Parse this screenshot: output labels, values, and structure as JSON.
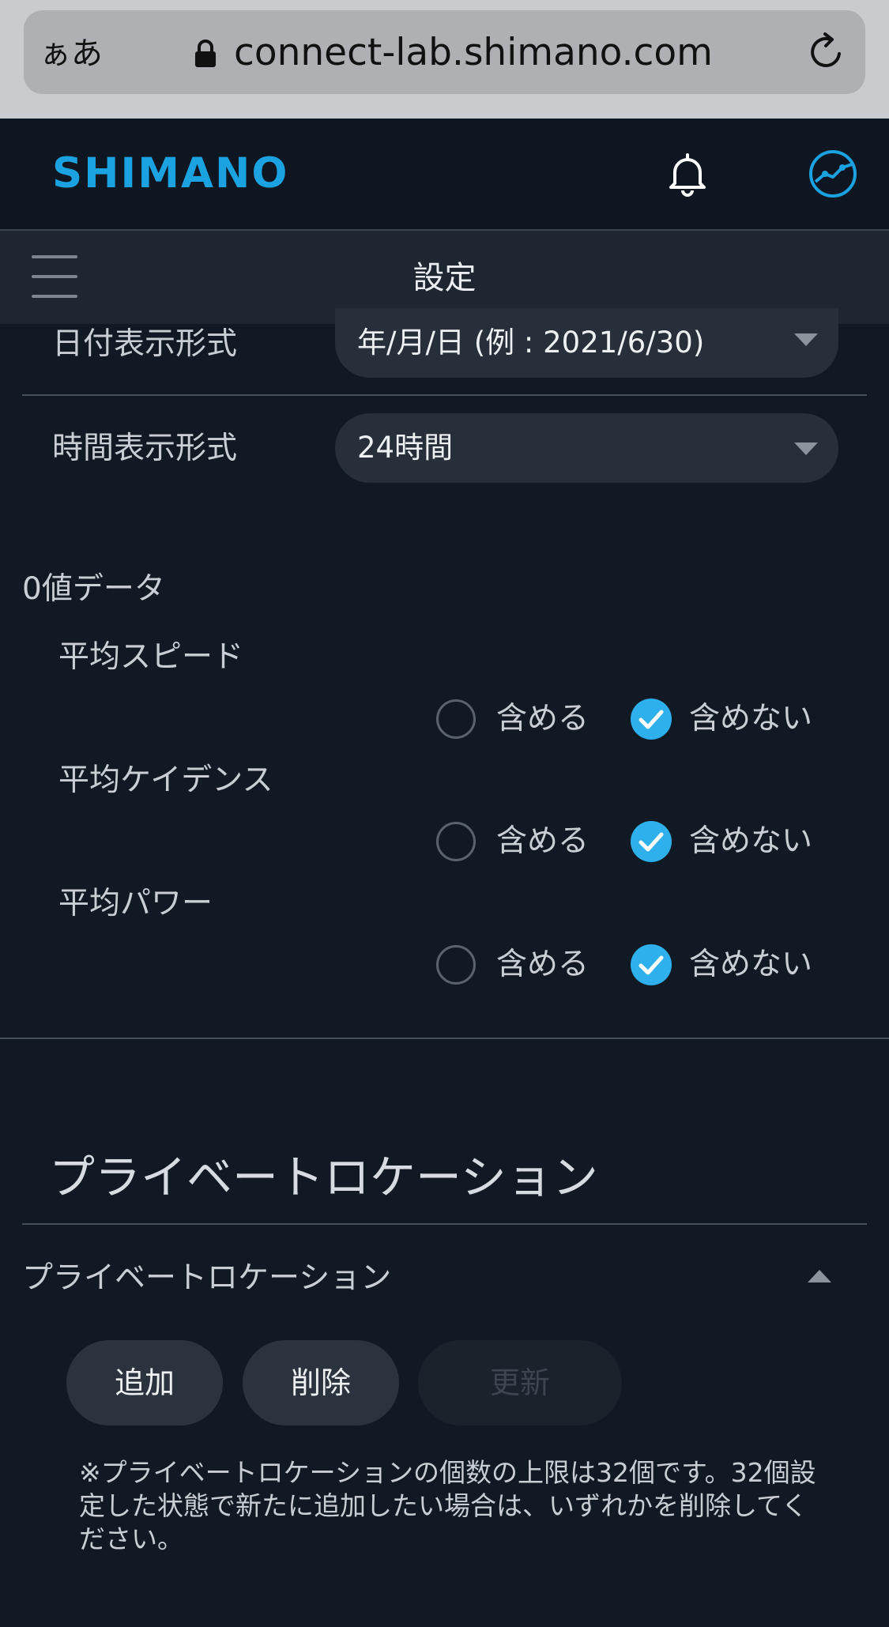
{
  "browser": {
    "aa_label": "ぁあ",
    "url": "connect-lab.shimano.com",
    "icons": [
      "lock-icon",
      "reload-icon"
    ]
  },
  "header": {
    "logo": "SHIMANO",
    "icons": [
      "bell-icon",
      "activity-icon"
    ],
    "accent_color": "#1aa3e0"
  },
  "titlebar": {
    "title": "設定"
  },
  "date_format": {
    "label": "日付表示形式",
    "value": "年/月/日 (例 : 2021/6/30)"
  },
  "time_format": {
    "label": "時間表示形式",
    "value": "24時間"
  },
  "zero_data": {
    "heading": "0値データ",
    "items": [
      {
        "label": "平均スピード",
        "include": "含める",
        "exclude": "含めない",
        "selected": "exclude"
      },
      {
        "label": "平均ケイデンス",
        "include": "含める",
        "exclude": "含めない",
        "selected": "exclude"
      },
      {
        "label": "平均パワー",
        "include": "含める",
        "exclude": "含めない",
        "selected": "exclude"
      }
    ]
  },
  "private_location": {
    "section_title": "プライベートロケーション",
    "subheading": "プライベートロケーション",
    "buttons": {
      "add": "追加",
      "delete": "削除",
      "update": "更新"
    },
    "note": "※プライベートロケーションの個数の上限は32個です。32個設定した状態で新たに追加したい場合は、いずれかを削除してください。"
  },
  "colors": {
    "check_blue": "#2eb0ec",
    "background": "#111a24"
  }
}
